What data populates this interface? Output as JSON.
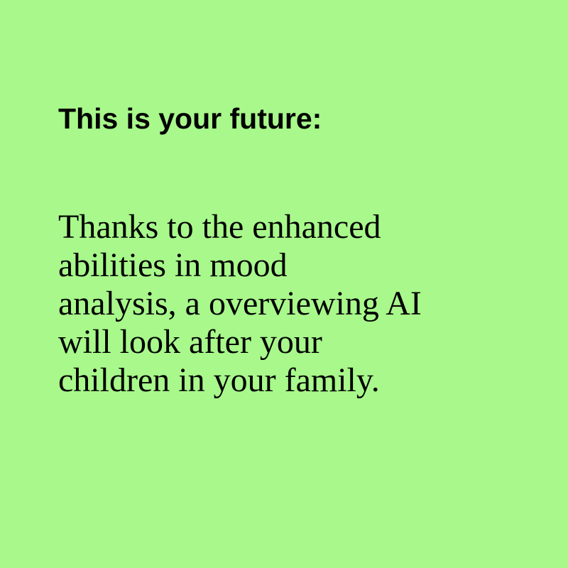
{
  "background_color": "#a8f88b",
  "text_color": "#000000",
  "heading": "This is your future:",
  "body_lines": [
    "Thanks to the enhanced",
    "abilities in mood",
    "analysis, a overviewing AI",
    "will look after your",
    "children in your family."
  ]
}
